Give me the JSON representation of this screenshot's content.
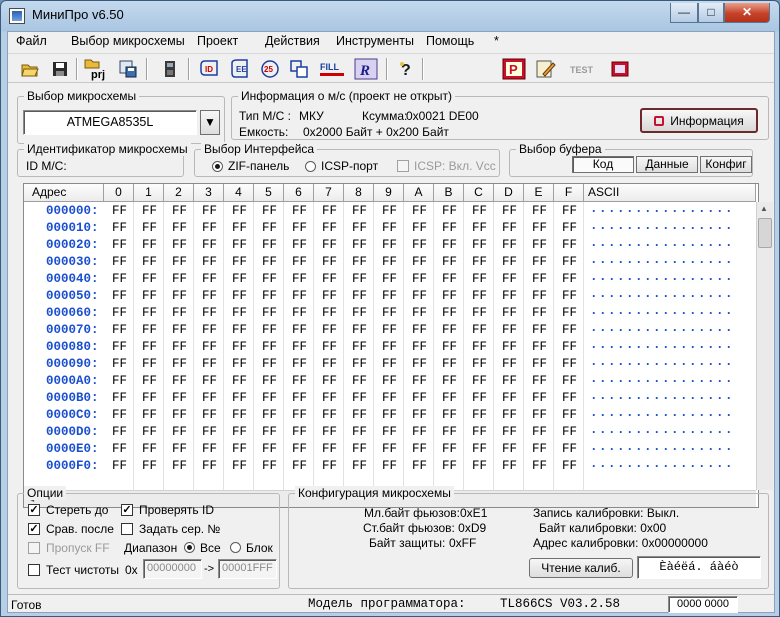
{
  "window": {
    "title": "МиниПро v6.50",
    "buttons": [
      "—",
      "□",
      "✕"
    ]
  },
  "menu": [
    "Файл",
    "Выбор микросхемы",
    "Проект",
    "Действия",
    "Инструменты",
    "Помощь",
    "*"
  ],
  "toolbar": {
    "prj_label": "prj",
    "fill_label": "FILL",
    "test_label": "TEST",
    "icons": [
      "open-icon",
      "save-icon",
      "project-icon",
      "save-project-icon",
      "chip-icon",
      "read-id-icon",
      "erase-icon",
      "blank-check-icon",
      "verify-icon",
      "fill-icon",
      "read-icon",
      "help-icon",
      "program-icon",
      "edit-icon",
      "test-icon",
      "chip-config-icon"
    ]
  },
  "chip_select": {
    "label": "Выбор микросхемы",
    "value": "ATMEGA8535L"
  },
  "info": {
    "label": "Информация о м/с (проект не открыт)",
    "type_label": "Тип М/С :",
    "type_value": "МКУ",
    "checksum_label": "Ксумма:",
    "checksum_value": "0x0021 DE00",
    "size_label": "Емкость:",
    "size_value": "0x2000 Байт  + 0x200 Байт",
    "button": "Информация"
  },
  "chip_id": {
    "label": "Идентификатор микросхемы",
    "id_label": "ID М/С:"
  },
  "interface": {
    "label": "Выбор Интерфейса",
    "zif": "ZIF-панель",
    "icsp": "ICSP-порт",
    "icsp_vcc": "ICSP: Вкл. Vcc"
  },
  "buffer": {
    "label": "Выбор буфера",
    "tabs": [
      "Код",
      "Данные",
      "Конфиг"
    ]
  },
  "hex": {
    "addr_header": "Адрес",
    "columns": [
      "0",
      "1",
      "2",
      "3",
      "4",
      "5",
      "6",
      "7",
      "8",
      "9",
      "A",
      "B",
      "C",
      "D",
      "E",
      "F"
    ],
    "ascii_header": "ASCII",
    "rows": [
      "000000:",
      "000010:",
      "000020:",
      "000030:",
      "000040:",
      "000050:",
      "000060:",
      "000070:",
      "000080:",
      "000090:",
      "0000A0:",
      "0000B0:",
      "0000C0:",
      "0000D0:",
      "0000E0:",
      "0000F0:"
    ],
    "cell": "FF",
    "ascii": "................"
  },
  "options": {
    "label": "Опции",
    "erase": "Стереть до",
    "verify_id": "Проверять ID",
    "compare": "Срав. после",
    "set_serial": "Задать сер. №",
    "skip_ff": "Пропуск FF",
    "range_label": "Диапазон",
    "range_all": "Все",
    "range_block": "Блок",
    "blank_test": "Тест чистоты",
    "hex_prefix": "0x",
    "range_from": "00000000",
    "range_arrow": "->",
    "range_to": "00001FFF"
  },
  "config": {
    "label": "Конфигурация микросхемы",
    "low_fuse": "Мл.байт фьюзов:0xE1",
    "high_fuse": "Ст.байт фьюзов: 0xD9",
    "lock_byte_label": "Байт защиты:",
    "lock_byte_value": "0xFF",
    "calib_write": "Запись калибровки: Выкл.",
    "calib_byte": "Байт калибровки: 0x00",
    "calib_addr": "Адрес калибровки: 0x00000000",
    "read_calib": "Чтение калиб.",
    "calib_text": "Èàéëá. áàéò"
  },
  "status": {
    "ready": "Готов",
    "model_label": "Модель программатора:",
    "model_value": "TL866CS V03.2.58",
    "counter": "0000 0000"
  }
}
